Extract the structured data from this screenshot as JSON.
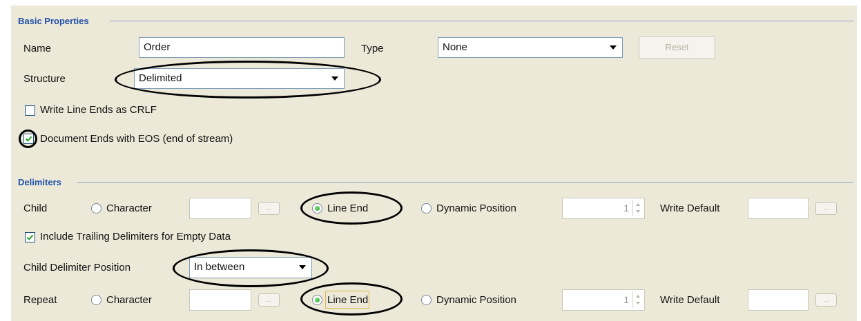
{
  "basic_properties": {
    "title": "Basic Properties",
    "name_label": "Name",
    "name_value": "Order",
    "type_label": "Type",
    "type_value": "None",
    "reset_label": "Reset",
    "structure_label": "Structure",
    "structure_value": "Delimited",
    "write_crlf_label": "Write Line Ends as CRLF",
    "write_crlf_checked": false,
    "eos_label": "Document Ends with EOS (end of stream)",
    "eos_checked": true
  },
  "delimiters": {
    "title": "Delimiters",
    "child_label": "Child",
    "repeat_label": "Repeat",
    "character_label": "Character",
    "line_end_label": "Line End",
    "dynamic_position_label": "Dynamic Position",
    "dynamic_position_value": "1",
    "write_default_label": "Write Default",
    "ellipsis_label": "...",
    "child_selected": "Line End",
    "repeat_selected": "Line End",
    "include_trailing_label": "Include Trailing Delimiters for Empty Data",
    "include_trailing_checked": true,
    "child_position_label": "Child Delimiter Position",
    "child_position_value": "In between"
  },
  "colors": {
    "panel_bg": "#ece9d8",
    "section_title": "#1f4fa8",
    "annotation": "#000000"
  }
}
